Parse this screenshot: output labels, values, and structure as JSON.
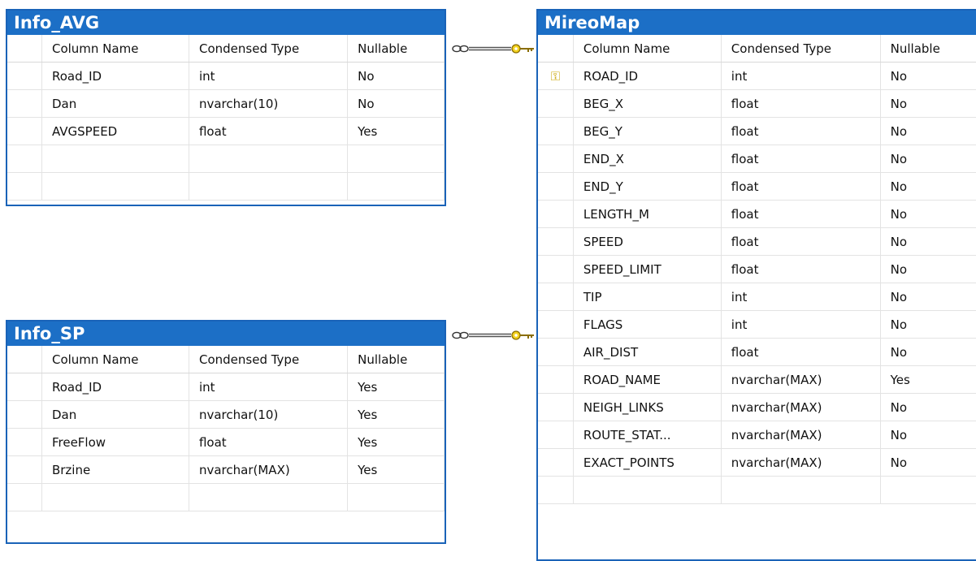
{
  "columns": {
    "name": "Column Name",
    "type": "Condensed Type",
    "nullable": "Nullable"
  },
  "tables": {
    "info_avg": {
      "title": "Info_AVG",
      "rows": [
        {
          "name": "Road_ID",
          "type": "int",
          "nullable": "No"
        },
        {
          "name": "Dan",
          "type": "nvarchar(10)",
          "nullable": "No"
        },
        {
          "name": "AVGSPEED",
          "type": "float",
          "nullable": "Yes"
        }
      ]
    },
    "info_sp": {
      "title": "Info_SP",
      "rows": [
        {
          "name": "Road_ID",
          "type": "int",
          "nullable": "Yes"
        },
        {
          "name": "Dan",
          "type": "nvarchar(10)",
          "nullable": "Yes"
        },
        {
          "name": "FreeFlow",
          "type": "float",
          "nullable": "Yes"
        },
        {
          "name": "Brzine",
          "type": "nvarchar(MAX)",
          "nullable": "Yes"
        }
      ]
    },
    "mireomap": {
      "title": "MireoMap",
      "primary_key_icon": "key-icon",
      "rows": [
        {
          "name": "ROAD_ID",
          "type": "int",
          "nullable": "No"
        },
        {
          "name": "BEG_X",
          "type": "float",
          "nullable": "No"
        },
        {
          "name": "BEG_Y",
          "type": "float",
          "nullable": "No"
        },
        {
          "name": "END_X",
          "type": "float",
          "nullable": "No"
        },
        {
          "name": "END_Y",
          "type": "float",
          "nullable": "No"
        },
        {
          "name": "LENGTH_M",
          "type": "float",
          "nullable": "No"
        },
        {
          "name": "SPEED",
          "type": "float",
          "nullable": "No"
        },
        {
          "name": "SPEED_LIMIT",
          "type": "float",
          "nullable": "No"
        },
        {
          "name": "TIP",
          "type": "int",
          "nullable": "No"
        },
        {
          "name": "FLAGS",
          "type": "int",
          "nullable": "No"
        },
        {
          "name": "AIR_DIST",
          "type": "float",
          "nullable": "No"
        },
        {
          "name": "ROAD_NAME",
          "type": "nvarchar(MAX)",
          "nullable": "Yes"
        },
        {
          "name": "NEIGH_LINKS",
          "type": "nvarchar(MAX)",
          "nullable": "No"
        },
        {
          "name": "ROUTE_STAT...",
          "type": "nvarchar(MAX)",
          "nullable": "No"
        },
        {
          "name": "EXACT_POINTS",
          "type": "nvarchar(MAX)",
          "nullable": "No"
        }
      ]
    }
  },
  "relationships": [
    {
      "from": "Info_AVG",
      "to": "MireoMap",
      "from_end": "many",
      "to_end": "one"
    },
    {
      "from": "Info_SP",
      "to": "MireoMap",
      "from_end": "many",
      "to_end": "one"
    }
  ],
  "colors": {
    "title_bar": "#1c6fc6",
    "border": "#1a63b8",
    "key": "#c9a400"
  }
}
